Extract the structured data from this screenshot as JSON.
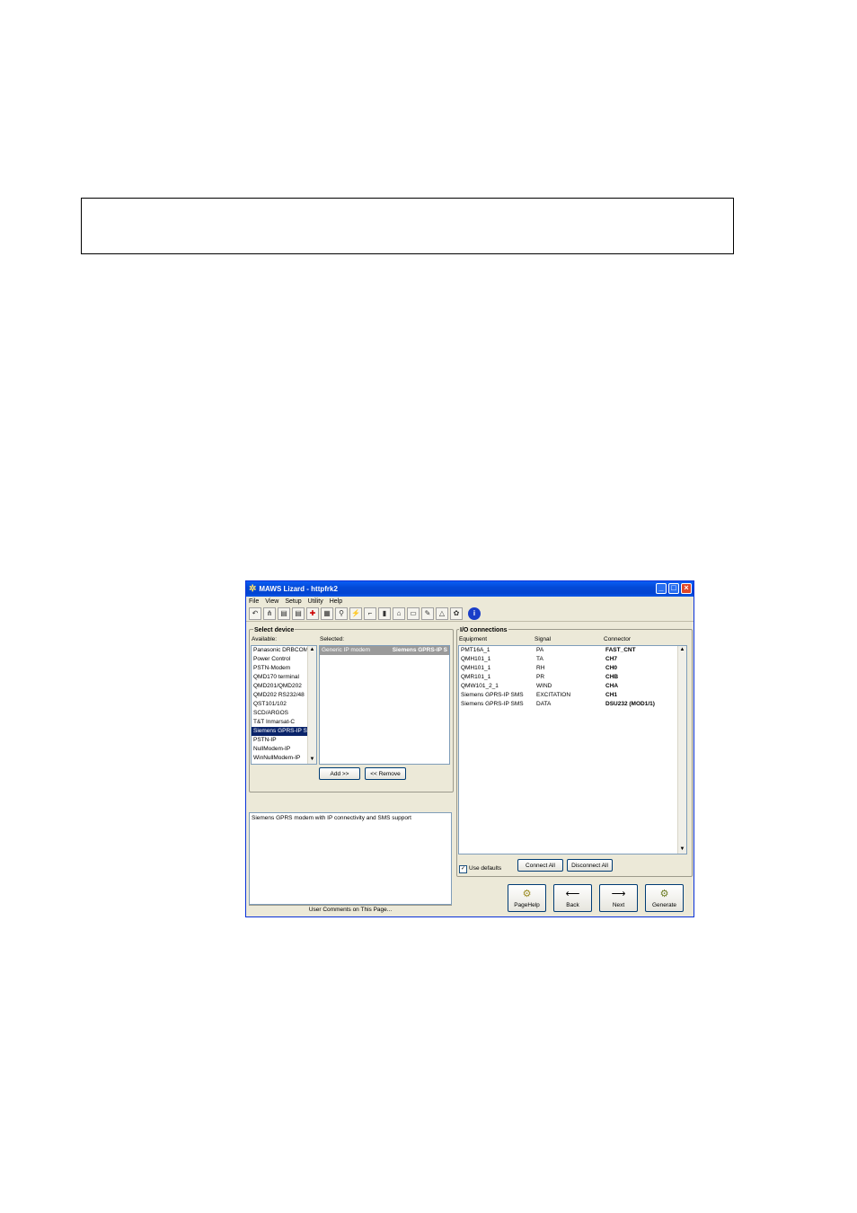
{
  "window": {
    "title": "MAWS Lizard - httpfrk2",
    "icons": {
      "app": "lizard-app-icon",
      "minimize": "minimize-icon",
      "maximize": "maximize-icon",
      "close": "close-icon"
    }
  },
  "menu": [
    "File",
    "View",
    "Setup",
    "Utility",
    "Help"
  ],
  "toolbar": {
    "icons": [
      "undo-icon",
      "network-icon",
      "dev-icon",
      "dev-icon",
      "flag-icon",
      "hardware-icon",
      "sensor-icon",
      "run-icon",
      "chart-icon",
      "battery-icon",
      "tree-icon",
      "page-icon",
      "pen-icon",
      "bell-icon",
      "gear-icon",
      "info-icon"
    ]
  },
  "select_device": {
    "title": "Select device",
    "available_label": "Available:",
    "selected_label": "Selected:",
    "available": [
      "Panasonic DRBCOM",
      "Power Control",
      "PSTN-Modem",
      "QMD170 terminal",
      "QMD201/QMD202",
      "QMD202 RS232/48",
      "QST101/102",
      "SCD/ARGOS",
      "T&T Inmarsat-C",
      "Siemens GPRS-IP S",
      "PSTN-IP",
      "NullModem-IP",
      "WinNullModem-IP"
    ],
    "available_selected_index": 9,
    "selected": [
      {
        "name": "Generic IP modem",
        "value": "Siemens GPRS-IP S"
      }
    ],
    "add_button": "Add >>",
    "remove_button": "<< Remove"
  },
  "description": {
    "text": "Siemens GPRS modem with IP connectivity and SMS support",
    "comments_label": "User Comments on This Page..."
  },
  "io": {
    "title": "I/O connections",
    "headers": [
      "Equipment",
      "Signal",
      "Connector"
    ],
    "rows": [
      [
        "PMT16A_1",
        "PA",
        "FAST_CNT"
      ],
      [
        "QMH101_1",
        "TA",
        "CH7"
      ],
      [
        "QMH101_1",
        "RH",
        "CH0"
      ],
      [
        "QMR101_1",
        "PR",
        "CHB"
      ],
      [
        "QMW101_2_1",
        "WIND",
        "CHA"
      ],
      [
        "Siemens GPRS-IP SMS",
        "EXCITATION",
        "CH1"
      ],
      [
        "Siemens GPRS-IP SMS",
        "DATA",
        "DSU232 (MOD1/1)"
      ]
    ],
    "use_defaults_label": "Use defaults",
    "use_defaults_checked": true,
    "connect_all": "Connect All",
    "disconnect_all": "Disconnect All"
  },
  "nav": {
    "pagehelp": "PageHelp",
    "back": "Back",
    "next": "Next",
    "generate": "Generate"
  }
}
